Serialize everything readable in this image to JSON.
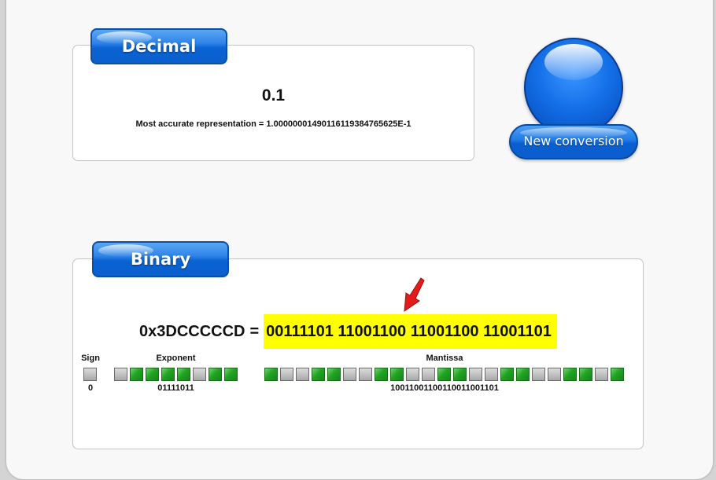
{
  "decimal": {
    "tab_label": "Decimal",
    "value": "0.1",
    "accurate_representation": "Most accurate representation = 1.00000001490116119384765625E-1"
  },
  "new_conversion": {
    "label": "New conversion"
  },
  "binary": {
    "tab_label": "Binary",
    "hex": "0x3DCCCCCD",
    "equals": "=",
    "binary_string": "00111101 11001100 11001100 11001101",
    "sign": {
      "label": "Sign",
      "value": "0",
      "bits": [
        0
      ]
    },
    "exponent": {
      "label": "Exponent",
      "value": "01111011",
      "bits": [
        0,
        1,
        1,
        1,
        1,
        0,
        1,
        1
      ]
    },
    "mantissa": {
      "label": "Mantissa",
      "value": "10011001100110011001101",
      "bits": [
        1,
        0,
        0,
        1,
        1,
        0,
        0,
        1,
        1,
        0,
        0,
        1,
        1,
        0,
        0,
        1,
        1,
        0,
        0,
        1,
        1,
        0,
        1
      ]
    }
  },
  "colors": {
    "bit_on": "#22a322",
    "bit_off": "#b8b8b8",
    "highlight": "#ffff00",
    "accent_blue": "#0a63d3",
    "arrow": "#e31b1b"
  }
}
